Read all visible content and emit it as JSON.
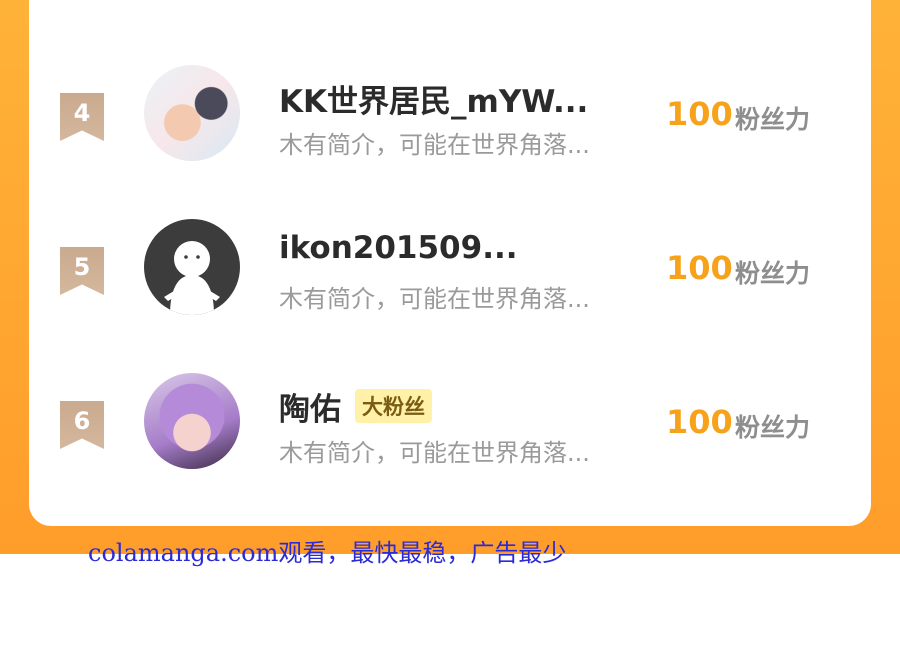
{
  "leaderboard": {
    "entries": [
      {
        "rank": "4",
        "name": "KK世界居民_mYW...",
        "bio": "木有简介，可能在世界角落...",
        "score": "100",
        "unit": "粉丝力"
      },
      {
        "rank": "5",
        "name": "ikon201509...",
        "bio": "木有简介，可能在世界角落...",
        "score": "100",
        "unit": "粉丝力"
      },
      {
        "rank": "6",
        "name": "陶佑",
        "badge": "大粉丝",
        "bio": "木有简介，可能在世界角落...",
        "score": "100",
        "unit": "粉丝力"
      }
    ]
  },
  "watermark": "colamanga.com观看，最快最稳，广告最少",
  "colors": {
    "orange": "#ffa52f",
    "score": "#f7a21b",
    "rank_badge": "#cdb096",
    "fan_badge": "#fff2a8"
  }
}
